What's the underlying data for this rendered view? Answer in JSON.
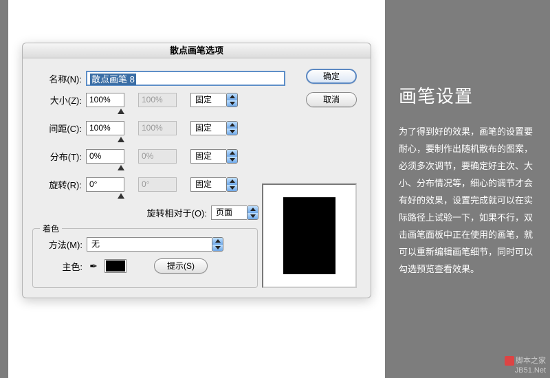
{
  "dialog": {
    "title": "散点画笔选项",
    "name_label": "名称(N):",
    "name_value": "散点画笔 8",
    "ok": "确定",
    "cancel": "取消",
    "rows": {
      "size": {
        "label": "大小(Z):",
        "v1": "100%",
        "v2": "100%",
        "mode": "固定"
      },
      "spacing": {
        "label": "间距(C):",
        "v1": "100%",
        "v2": "100%",
        "mode": "固定"
      },
      "scatter": {
        "label": "分布(T):",
        "v1": "0%",
        "v2": "0%",
        "mode": "固定"
      },
      "rotate": {
        "label": "旋转(R):",
        "v1": "0°",
        "v2": "0°",
        "mode": "固定"
      }
    },
    "rotate_relative_label": "旋转相对于(O):",
    "rotate_relative_value": "页面",
    "color_group": {
      "legend": "着色",
      "method_label": "方法(M):",
      "method_value": "无",
      "key_label": "主色:",
      "hint": "提示(S)"
    }
  },
  "sidebar": {
    "heading": "画笔设置",
    "body": "为了得到好的效果，画笔的设置要耐心，要制作出随机散布的图案，必须多次调节，要确定好主次、大小、分布情况等，细心的调节才会有好的效果，设置完成就可以在实际路径上试验一下，如果不行，双击画笔面板中正在使用的画笔，就可以重新编辑画笔细节，同时可以勾选预览查看效果。"
  },
  "watermark": {
    "line1": "脚本之家",
    "line2": "JB51.Net"
  }
}
